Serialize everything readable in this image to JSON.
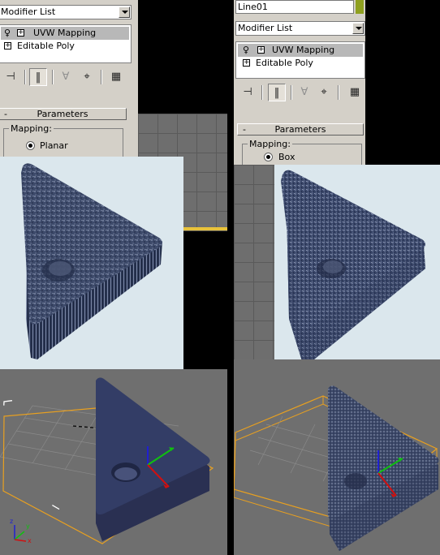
{
  "left": {
    "modifier_list": "Modifier List",
    "stack": [
      {
        "label": "UVW Mapping",
        "selected": true
      },
      {
        "label": "Editable Poly",
        "selected": false
      }
    ],
    "rollout_title": "Parameters",
    "rollout_minus": "-",
    "mapping_label": "Mapping:",
    "mapping_value": "Planar"
  },
  "right": {
    "object_name": "Line01",
    "modifier_list": "Modifier List",
    "stack": [
      {
        "label": "UVW Mapping",
        "selected": true
      },
      {
        "label": "Editable Poly",
        "selected": false
      }
    ],
    "rollout_title": "Parameters",
    "rollout_minus": "-",
    "mapping_label": "Mapping:",
    "mapping_value": "Box"
  },
  "colors": {
    "panel_bg": "#d4d0c8",
    "render_bg": "#dbe7ed",
    "viewport_bg": "#6f6f6f",
    "selection_orange": "#e8a020",
    "object_blue": "#333d66",
    "gizmo_x": "#d01010",
    "gizmo_y": "#10c010",
    "gizmo_z": "#2020d0"
  },
  "icons": [
    "light-bulb-icon",
    "pin-stack-icon",
    "show-end-result-icon",
    "make-unique-icon",
    "remove-modifier-icon",
    "configure-modifier-sets-icon",
    "plus-expand-icon",
    "axis-tripod-icon"
  ],
  "axis_labels": {
    "x": "x",
    "y": "y",
    "z": "z"
  },
  "toolbar_glyphs": {
    "pin": "⊣",
    "end_result": "‖",
    "unique": "∀",
    "remove": "⌖",
    "configure": "▦"
  },
  "expand_glyph": "+",
  "light_glyph": "♀"
}
